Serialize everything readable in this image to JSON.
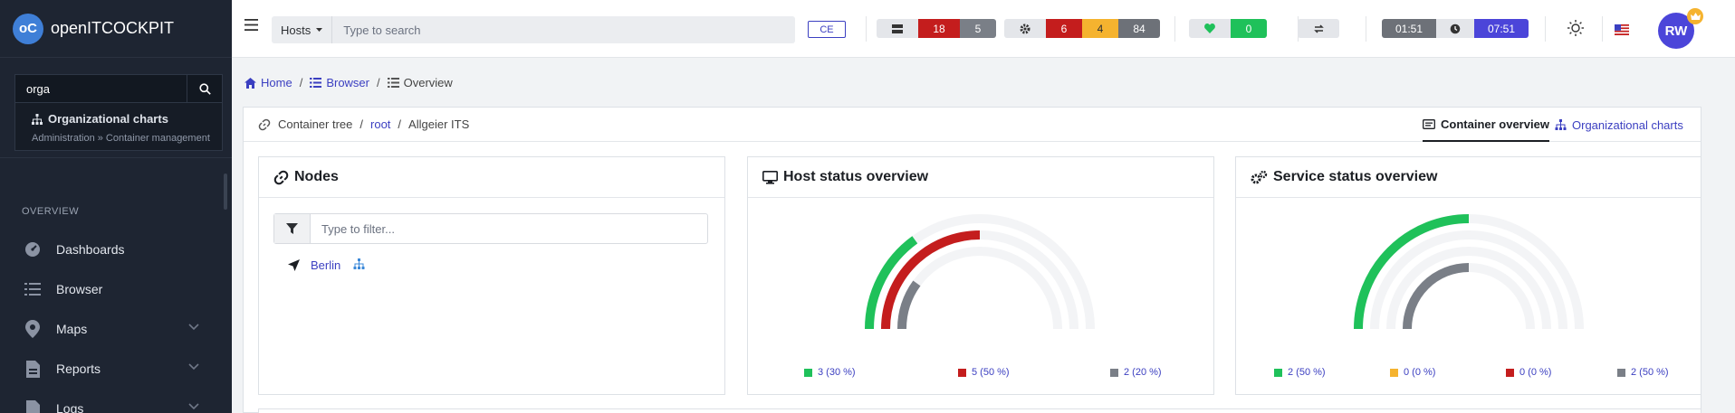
{
  "app": {
    "name": "openITCOCKPIT",
    "logo_letters": "oC"
  },
  "sidebar": {
    "search_value": "orga",
    "search_result": {
      "title": "Organizational charts",
      "path": "Administration » Container management"
    },
    "section_header": "OVERVIEW",
    "items": [
      {
        "label": "Dashboards",
        "icon": "dashboard-icon",
        "expandable": false
      },
      {
        "label": "Browser",
        "icon": "list-icon",
        "expandable": false
      },
      {
        "label": "Maps",
        "icon": "map-pin-icon",
        "expandable": true
      },
      {
        "label": "Reports",
        "icon": "report-icon",
        "expandable": true
      },
      {
        "label": "Logs",
        "icon": "log-icon",
        "expandable": true
      }
    ]
  },
  "topbar": {
    "search_type": "Hosts",
    "search_placeholder": "Type to search",
    "edition": "CE",
    "host_counts": {
      "down": "18",
      "unreachable": "5"
    },
    "service_counts": {
      "critical": "6",
      "warning": "4",
      "unknown": "84"
    },
    "health_count": "0",
    "server_time": "01:51",
    "user_time": "07:51",
    "avatar_initials": "RW"
  },
  "breadcrumb": {
    "home": "Home",
    "browser": "Browser",
    "current": "Overview"
  },
  "container": {
    "tree_label": "Container tree",
    "root": "root",
    "current": "Allgeier ITS",
    "tab_active": "Container overview",
    "tab_other": "Organizational charts"
  },
  "nodes": {
    "title": "Nodes",
    "filter_placeholder": "Type to filter...",
    "items": [
      "Berlin"
    ]
  },
  "host_status": {
    "title": "Host status overview",
    "legend": [
      "3 (30 %)",
      "5 (50 %)",
      "2 (20 %)"
    ],
    "fractions": [
      0.3,
      0.5,
      0.2
    ]
  },
  "service_status": {
    "title": "Service status overview",
    "legend": [
      "2 (50 %)",
      "0 (0 %)",
      "0 (0 %)",
      "2 (50 %)"
    ],
    "fractions": [
      0.5,
      0.0,
      0.0,
      0.5
    ]
  },
  "colors": {
    "ok": "#1fc15a",
    "warning": "#f5b32f",
    "critical": "#c41d1d",
    "unknown": "#7a7f87",
    "accent": "#3b3fc1",
    "track": "#f3f4f6"
  }
}
